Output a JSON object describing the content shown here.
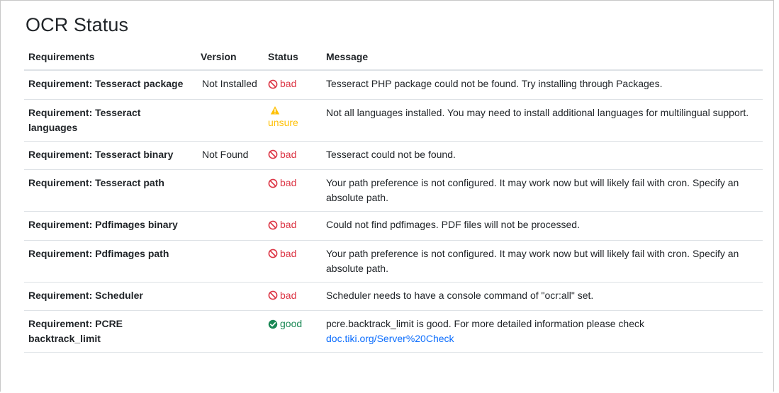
{
  "page": {
    "title": "OCR Status"
  },
  "table": {
    "headers": [
      "Requirements",
      "Version",
      "Status",
      "Message"
    ],
    "rows": [
      {
        "requirement": "Requirement: Tesseract package",
        "version": "Not Installed",
        "status": "bad",
        "icon": "ban-icon",
        "message": "Tesseract PHP package could not be found. Try installing through Packages."
      },
      {
        "requirement": "Requirement: Tesseract languages",
        "version": "",
        "status": "unsure",
        "icon": "warning-icon",
        "message": "Not all languages installed. You may need to install additional languages for multilingual support."
      },
      {
        "requirement": "Requirement: Tesseract binary",
        "version": "Not Found",
        "status": "bad",
        "icon": "ban-icon",
        "message": "Tesseract could not be found."
      },
      {
        "requirement": "Requirement: Tesseract path",
        "version": "",
        "status": "bad",
        "icon": "ban-icon",
        "message": "Your path preference is not configured. It may work now but will likely fail with cron. Specify an absolute path."
      },
      {
        "requirement": "Requirement: Pdfimages binary",
        "version": "",
        "status": "bad",
        "icon": "ban-icon",
        "message": "Could not find pdfimages. PDF files will not be processed."
      },
      {
        "requirement": "Requirement: Pdfimages path",
        "version": "",
        "status": "bad",
        "icon": "ban-icon",
        "message": "Your path preference is not configured. It may work now but will likely fail with cron. Specify an absolute path."
      },
      {
        "requirement": "Requirement: Scheduler",
        "version": "",
        "status": "bad",
        "icon": "ban-icon",
        "message": "Scheduler needs to have a console command of \"ocr:all\" set."
      },
      {
        "requirement": "Requirement: PCRE backtrack_limit",
        "version": "",
        "status": "good",
        "icon": "check-circle-icon",
        "message": "pcre.backtrack_limit is good. For more detailed information please check",
        "link": "doc.tiki.org/Server%20Check"
      }
    ]
  },
  "colors": {
    "bad": "#dc3545",
    "unsure": "#ffc107",
    "good": "#198754",
    "link": "#0d6efd"
  }
}
